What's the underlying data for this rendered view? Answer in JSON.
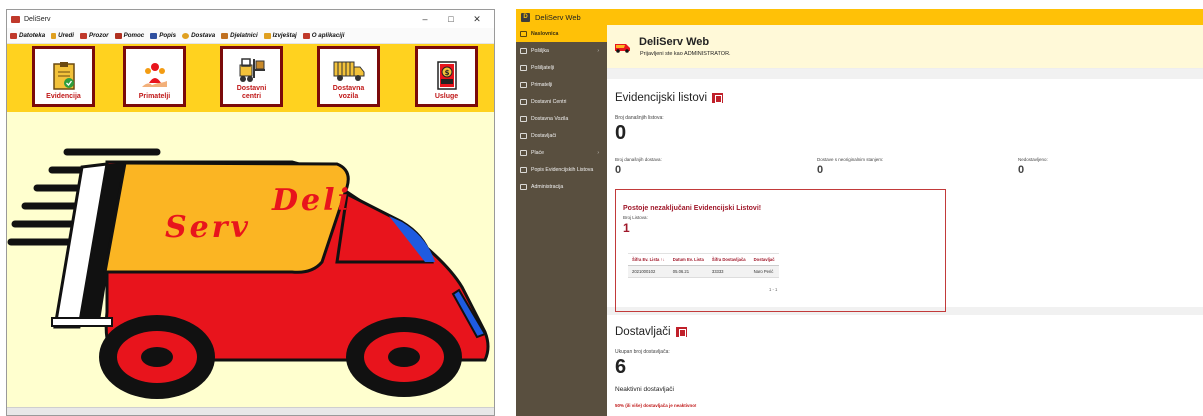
{
  "desktop": {
    "title": "DeliServ",
    "window_controls": {
      "minimize": "–",
      "maximize": "□",
      "close": "✕"
    },
    "menu": [
      {
        "label": "Datoteka",
        "icon": "folder-icon",
        "color": "#c0392b"
      },
      {
        "label": "Uredi",
        "icon": "pencil-icon",
        "color": "#e0a020"
      },
      {
        "label": "Prozor",
        "icon": "window-icon",
        "color": "#c0392b"
      },
      {
        "label": "Pomoc",
        "icon": "help-icon",
        "color": "#b03020"
      },
      {
        "label": "Popis",
        "icon": "list-icon",
        "color": "#3050a0"
      },
      {
        "label": "Dostava",
        "icon": "bulb-icon",
        "color": "#e0a020"
      },
      {
        "label": "Djelatnici",
        "icon": "worker-icon",
        "color": "#c07020"
      },
      {
        "label": "Izvještaj",
        "icon": "report-icon",
        "color": "#e0a020"
      },
      {
        "label": "O aplikaciji",
        "icon": "info-icon",
        "color": "#c0392b"
      }
    ],
    "toolbar": [
      {
        "label": "Evidencija",
        "icon": "clipboard-icon"
      },
      {
        "label": "Primatelji",
        "icon": "people-icon"
      },
      {
        "label": "Dostavni centri",
        "icon": "forklift-icon"
      },
      {
        "label": "Dostavna vozila",
        "icon": "truck-icon"
      },
      {
        "label": "Usluge",
        "icon": "coin-icon"
      }
    ],
    "logo_text": {
      "line1": "Deli",
      "line2": "Serv"
    },
    "colors": {
      "toolbar_bg": "#ffd21f",
      "button_frame": "#7b0a0a",
      "canvas_bg": "#ffffcf",
      "truck_red": "#e8141c"
    }
  },
  "web": {
    "app_title": "DeliServ Web",
    "sidebar": [
      {
        "label": "Naslovnica",
        "active": true,
        "chevron": false
      },
      {
        "label": "Pošiljka",
        "active": false,
        "chevron": true
      },
      {
        "label": "Pošiljatelji",
        "active": false,
        "chevron": false
      },
      {
        "label": "Primatelji",
        "active": false,
        "chevron": false
      },
      {
        "label": "Dostavni Centri",
        "active": false,
        "chevron": false
      },
      {
        "label": "Dostavna Vozila",
        "active": false,
        "chevron": false
      },
      {
        "label": "Dostavljači",
        "active": false,
        "chevron": false
      },
      {
        "label": "Plaće",
        "active": false,
        "chevron": true
      },
      {
        "label": "Popis Evidencijskih Listova",
        "active": false,
        "chevron": false
      },
      {
        "label": "Administracija",
        "active": false,
        "chevron": false
      }
    ],
    "welcome": {
      "title": "DeliServ Web",
      "subtitle": "Prijavljeni ste kao ADMINISTRATOR."
    },
    "evidencijski": {
      "title": "Evidencijski listovi",
      "broj_label": "Broj današnjih listova:",
      "broj_value": "0",
      "stats": [
        {
          "label": "Broj današnjih dostava:",
          "value": "0"
        },
        {
          "label": "Dostave s neoriginalnim stanjem:",
          "value": "0"
        },
        {
          "label": "Nedostavljeno:",
          "value": "0"
        }
      ],
      "alert": {
        "title": "Postoje nezaključani Evidencijski Listovi!",
        "label": "Broj Listova:",
        "value": "1",
        "headers": [
          "Šifra Ev. Lista ↑↓",
          "Datum Ev. Lista",
          "Šifra Dostavljača",
          "Dostavljač"
        ],
        "rows": [
          [
            "2021000102",
            "05.06.21",
            "33333",
            "Naro Perić"
          ]
        ],
        "pager": "1 - 1"
      }
    },
    "dostavljaci": {
      "title": "Dostavljači",
      "ukupan_label": "Ukupan broj dostavljača:",
      "ukupan_value": "6",
      "neaktivni_label": "Neaktivni dostavljači",
      "warning": "50% (ili više) dostavljača je neaktivno!"
    },
    "colors": {
      "topbar": "#ffc107",
      "sidebar": "#594f3f",
      "accent_red": "#c0202a"
    }
  }
}
